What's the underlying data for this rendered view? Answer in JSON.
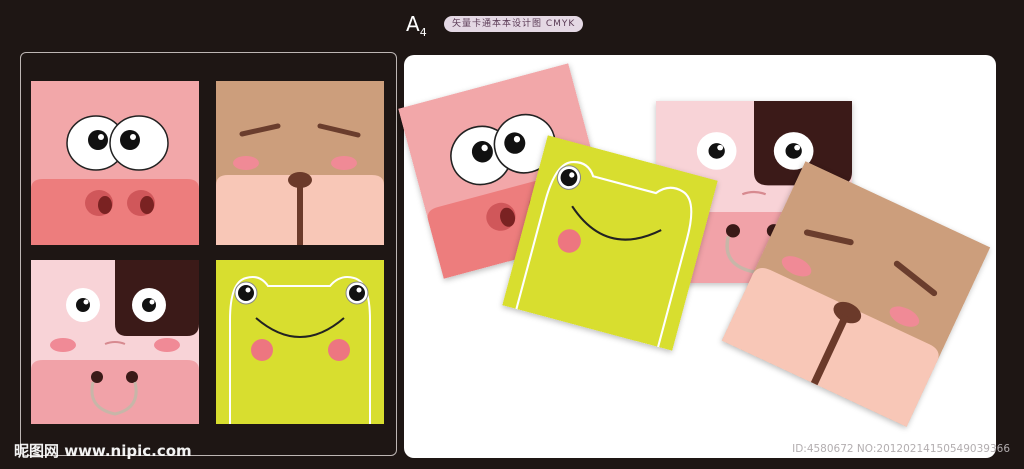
{
  "header": {
    "paper_size": "A",
    "paper_size_num": "4",
    "title": "矢量卡通本本设计图 CMYK"
  },
  "watermark": {
    "site": "昵图网 www.nipic.com",
    "id_text": "ID:4580672 NO:20120214150549039366"
  },
  "colors": {
    "background": "#1e1614",
    "pig": "#f2a7a9",
    "bear": "#cc9e7c",
    "cow": "#f8d3d7",
    "frog": "#d8de2f"
  },
  "cards": [
    "pig",
    "bear",
    "cow",
    "frog"
  ]
}
